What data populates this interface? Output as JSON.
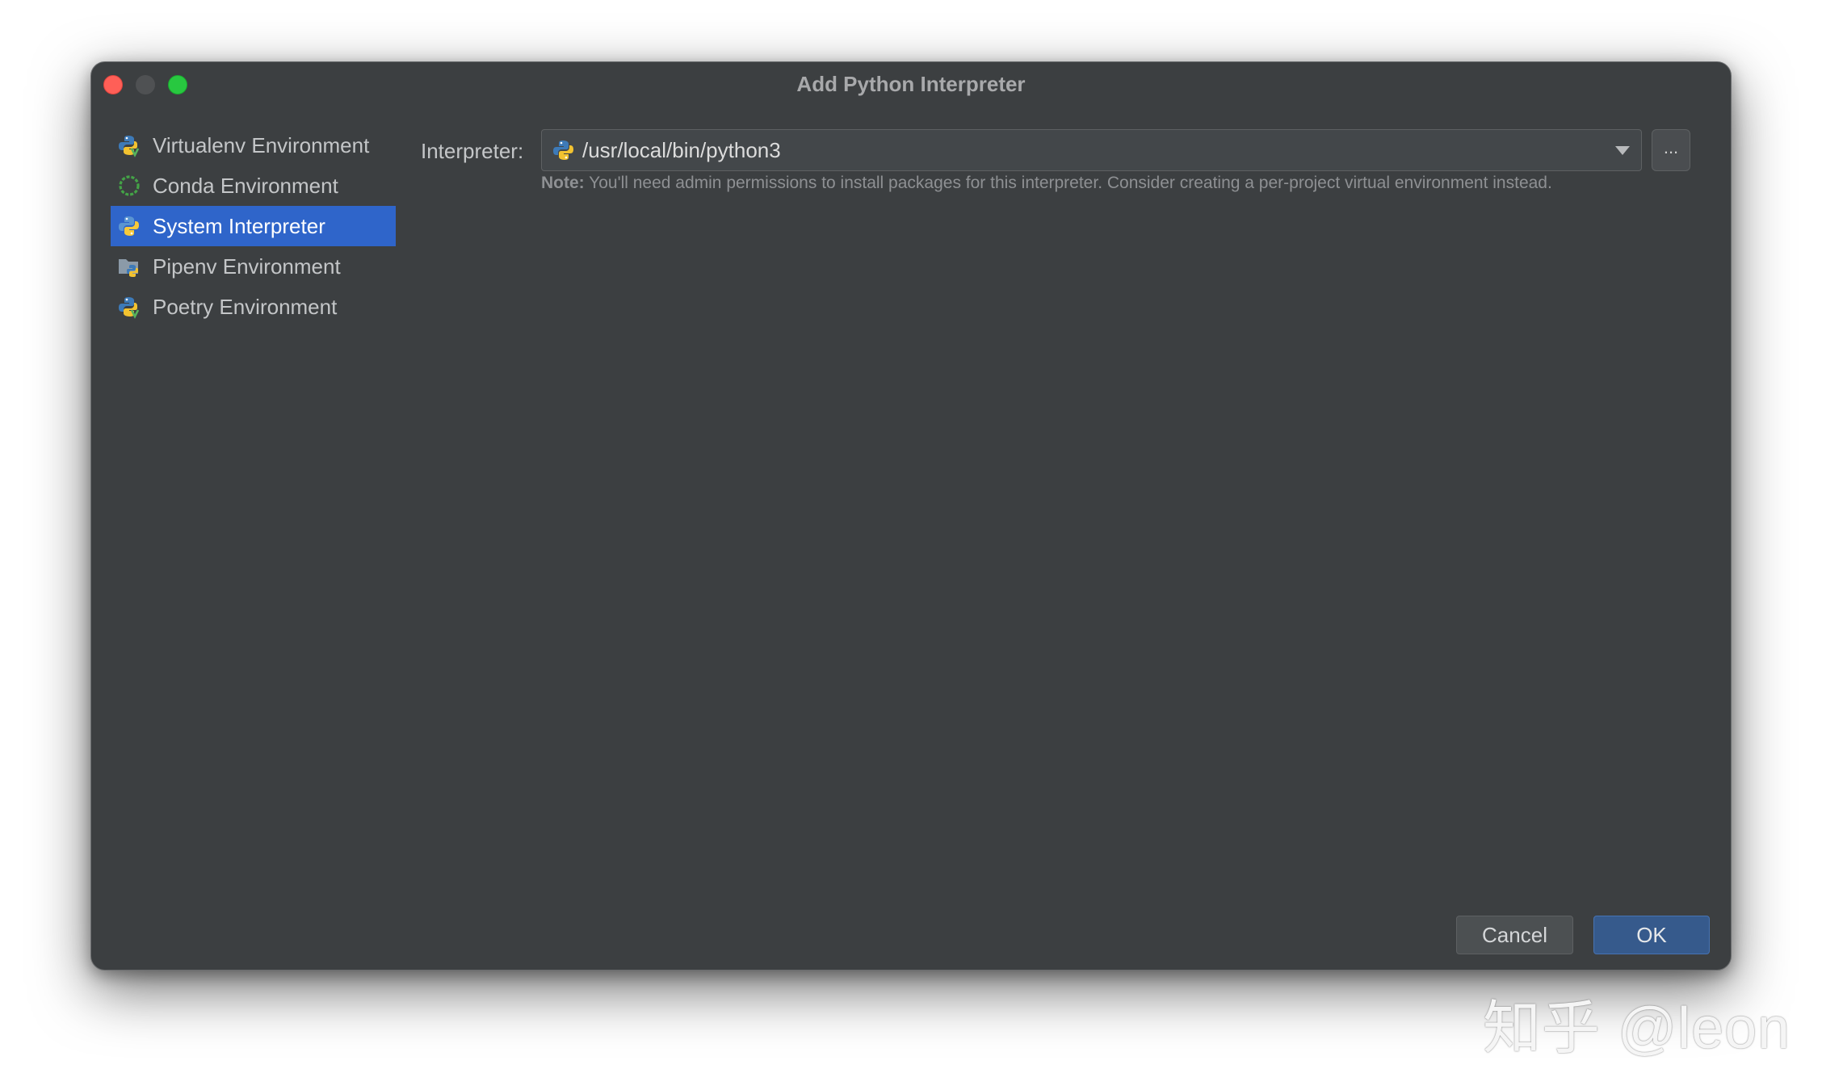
{
  "window": {
    "title": "Add Python Interpreter"
  },
  "sidebar": {
    "items": [
      {
        "label": "Virtualenv Environment",
        "icon": "python-virtualenv-icon"
      },
      {
        "label": "Conda Environment",
        "icon": "conda-icon"
      },
      {
        "label": "System Interpreter",
        "icon": "python-icon",
        "selected": true
      },
      {
        "label": "Pipenv Environment",
        "icon": "pipenv-icon"
      },
      {
        "label": "Poetry Environment",
        "icon": "poetry-icon"
      }
    ]
  },
  "main": {
    "interpreter_label": "Interpreter:",
    "interpreter_value": "/usr/local/bin/python3",
    "browse_label": "...",
    "note_prefix": "Note:",
    "note_text": " You'll need admin permissions to install packages for this interpreter. Consider creating a per-project virtual environment instead."
  },
  "buttons": {
    "cancel": "Cancel",
    "ok": "OK"
  },
  "watermark": "知乎 @leon",
  "colors": {
    "window_bg": "#3c3f41",
    "selection": "#2f65ca",
    "ok_button": "#365a8c",
    "close": "#ff5f57",
    "maximize": "#28c840"
  }
}
